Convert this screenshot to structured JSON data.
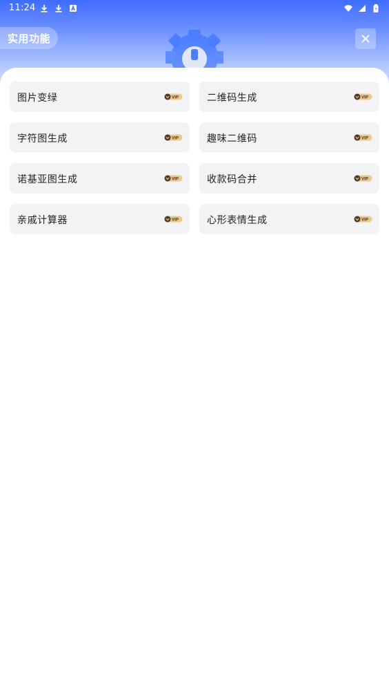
{
  "statusbar": {
    "time": "11:24",
    "left_icons": [
      "download-icon",
      "download-icon",
      "a-icon"
    ],
    "right_icons": [
      "wifi-icon",
      "signal-icon",
      "battery-icon"
    ]
  },
  "header": {
    "title": "实用功能",
    "close_icon": "close-icon",
    "hero_icon": "gear-icon"
  },
  "tools": [
    {
      "label": "图片变绿",
      "badge": "VIP"
    },
    {
      "label": "二维码生成",
      "badge": "VIP"
    },
    {
      "label": "字符图生成",
      "badge": "VIP"
    },
    {
      "label": "趣味二维码",
      "badge": "VIP"
    },
    {
      "label": "诺基亚图生成",
      "badge": "VIP"
    },
    {
      "label": "收款码合并",
      "badge": "VIP"
    },
    {
      "label": "亲戚计算器",
      "badge": "VIP"
    },
    {
      "label": "心形表情生成",
      "badge": "VIP"
    }
  ],
  "colors": {
    "hero_blue": "#3f6cff",
    "card_bg": "#f3f3f5",
    "vip_gold": "#e9c98e",
    "vip_dark": "#4b3a2b"
  }
}
